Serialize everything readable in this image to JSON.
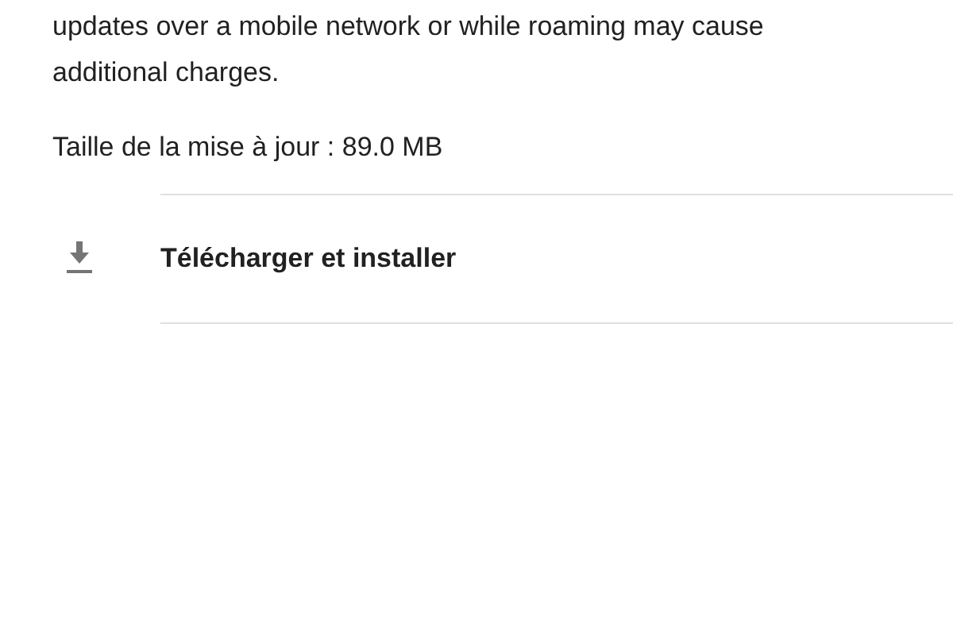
{
  "notice": {
    "text": "updates over a mobile network or while roaming may cause additional charges."
  },
  "update_size": "Taille de la mise à jour : 89.0 MB",
  "actions": [
    {
      "kind": "download",
      "label": "Télécharger et installer"
    }
  ]
}
